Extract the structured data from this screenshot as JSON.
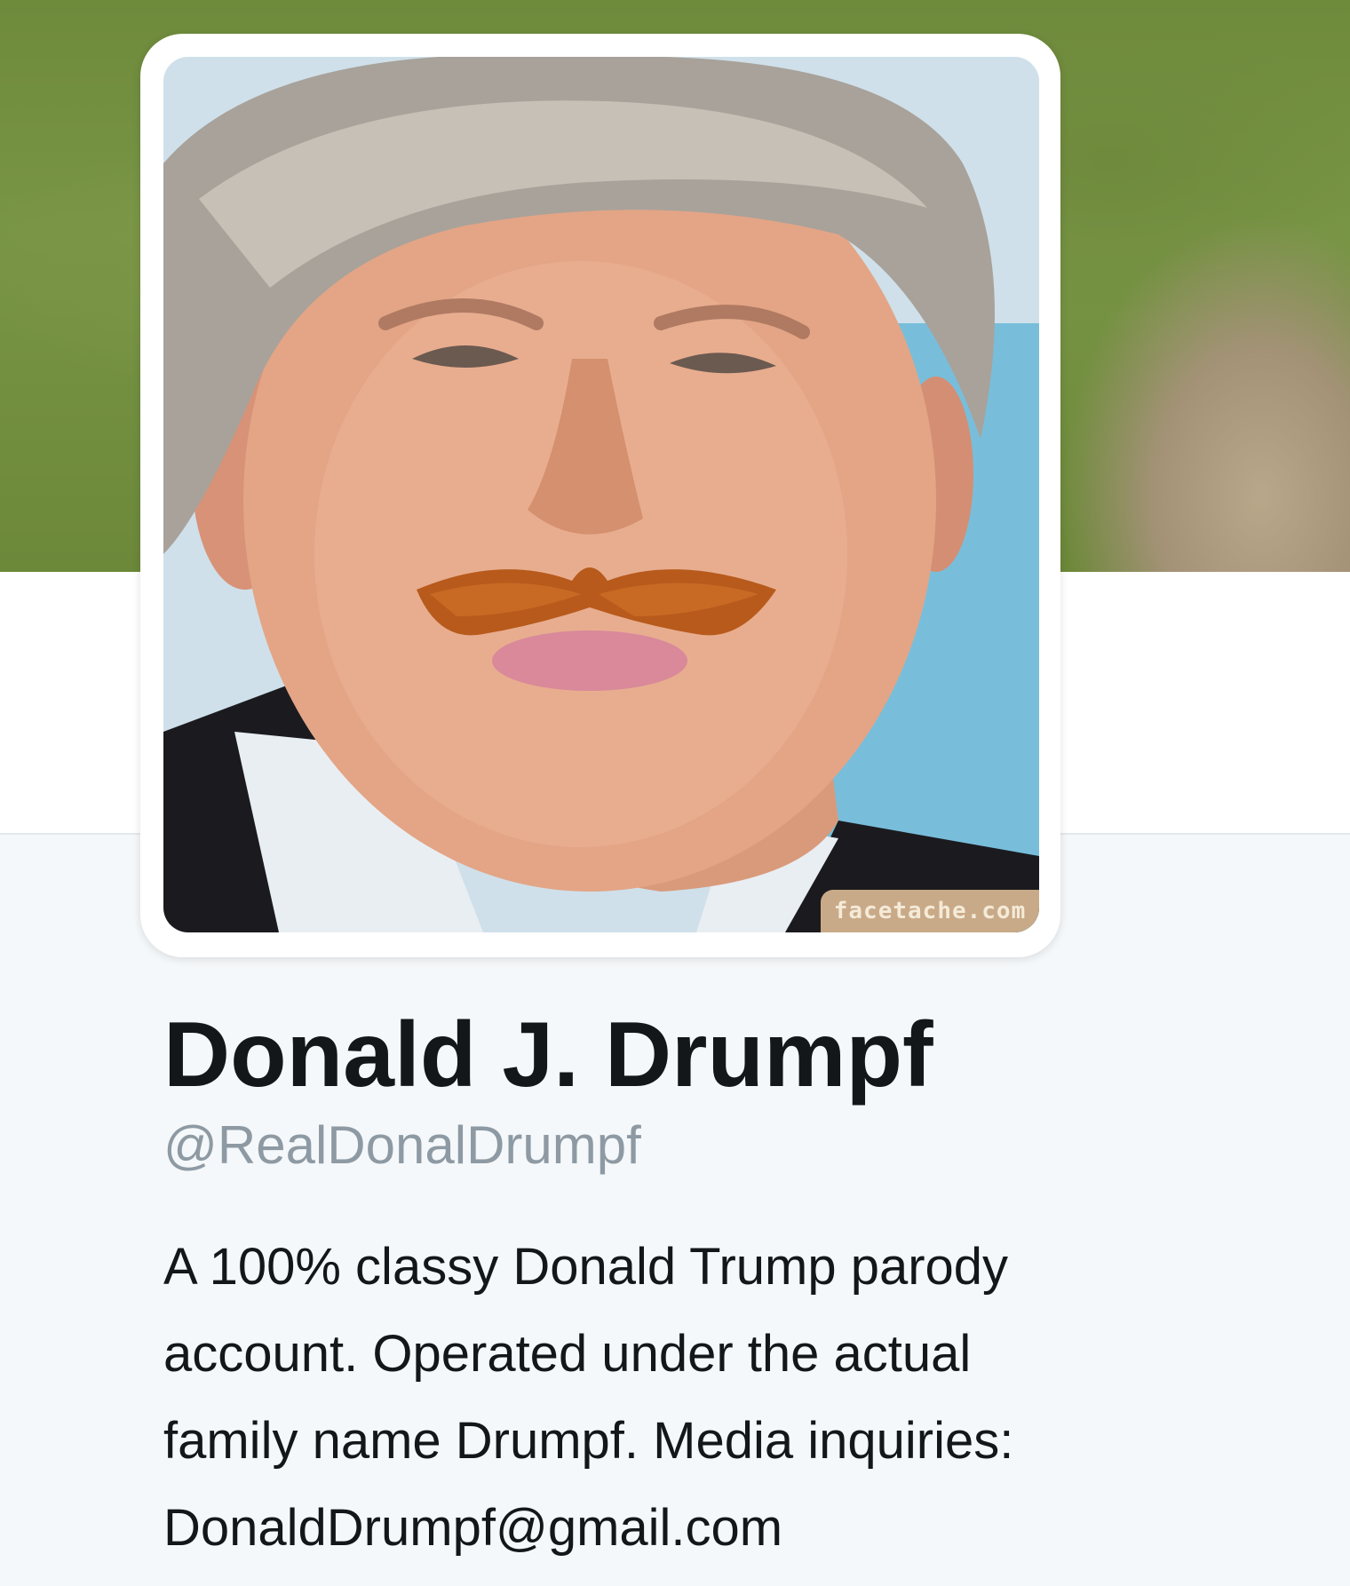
{
  "profile": {
    "display_name": "Donald J. Drumpf",
    "handle": "@RealDonalDrumpf",
    "bio_lines": [
      "A 100% classy Donald Trump parody",
      "account. Operated under the actual",
      "family name Drumpf. Media inquiries:",
      "DonaldDrumpf@gmail.com"
    ],
    "avatar_watermark": "facetache.com"
  },
  "colors": {
    "name_text": "#14171a",
    "handle_text": "#8e9aa3",
    "page_background": "#f5f8fa",
    "banner_green": "#6e8a3b"
  }
}
